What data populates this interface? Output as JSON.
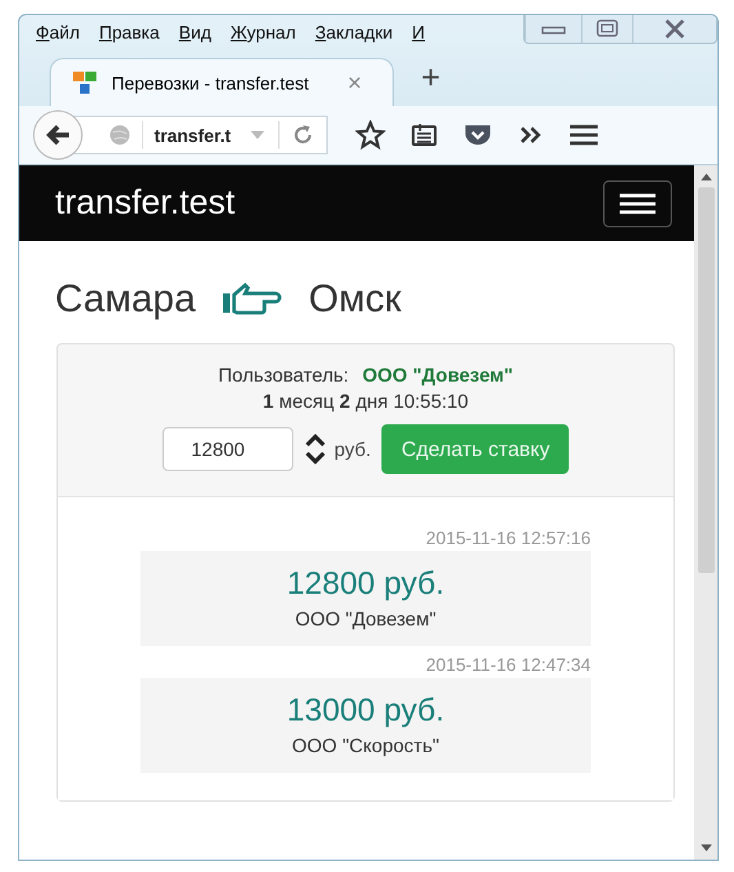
{
  "menu": [
    "Файл",
    "Правка",
    "Вид",
    "Журнал",
    "Закладки",
    "И"
  ],
  "tab": {
    "title": "Перевозки - transfer.test",
    "close": "×",
    "new": "+"
  },
  "address": {
    "value": "transfer.t"
  },
  "navbar": {
    "brand": "transfer.test"
  },
  "route": {
    "from": "Самара",
    "to": "Омск"
  },
  "bid_panel": {
    "user_label": "Пользователь:",
    "user": "ООО \"Довезем\"",
    "countdown": "**1** месяц **2** дня 10:55:10",
    "amount": "12800",
    "unit": "руб.",
    "button": "Сделать ставку"
  },
  "bids": [
    {
      "time": "2015-11-16 12:57:16",
      "amount": "12800 руб.",
      "company": "ООО \"Довезем\""
    },
    {
      "time": "2015-11-16 12:47:34",
      "amount": "13000 руб.",
      "company": "ООО \"Скорость\""
    }
  ]
}
